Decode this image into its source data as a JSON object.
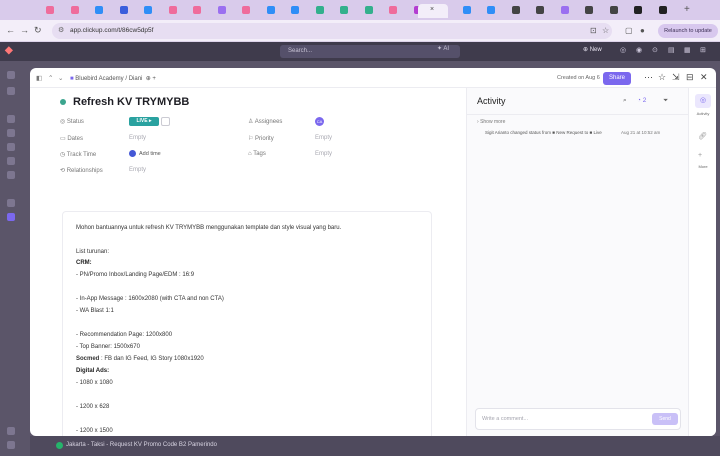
{
  "browser": {
    "url": "app.clickup.com/t/86cw5dp5f",
    "relaunch_label": "Relaunch to update",
    "tab_colors": [
      "#ef6c9b",
      "#ef6c9b",
      "#2f8ef7",
      "#3a5ddc",
      "#2f8ef7",
      "#ef6c9b",
      "#ef6c9b",
      "#9b6ff0",
      "#ef6c9b",
      "#2f8ef7",
      "#2f8ef7",
      "#33b08c",
      "#33b08c",
      "#33b08c",
      "#ef6c9b",
      "#b33dd1",
      "#e1b12c",
      "#2f8ef7",
      "#2f8ef7",
      "#444",
      "#444",
      "#9b6ff0",
      "#444",
      "#444",
      "#222",
      "#222"
    ]
  },
  "app": {
    "search_placeholder": "Search...",
    "ai_label": "AI",
    "new_label": "New"
  },
  "breadcrumb": {
    "space": "Bluebird Academy",
    "list": "Diani"
  },
  "header": {
    "created": "Created on Aug 6",
    "share_label": "Share"
  },
  "task": {
    "title": "Refresh KV TRYMYBB",
    "status_label": "Status",
    "status_value": "LIVE",
    "assignees_label": "Assignees",
    "assignee_initials": "CA",
    "dates_label": "Dates",
    "dates_value": "Empty",
    "priority_label": "Priority",
    "priority_value": "Empty",
    "track_label": "Track Time",
    "track_value": "Add time",
    "tags_label": "Tags",
    "tags_value": "Empty",
    "relationships_label": "Relationships",
    "relationships_value": "Empty"
  },
  "description": {
    "l1": "Mohon bantuannya untuk refresh KV TRYMYBB menggunakan template dan style visual yang baru.",
    "l2": "List turunan:",
    "l3": "CRM:",
    "l4": "- PN/Promo Inbox/Landing Page/EDM : 16:9",
    "l5": "- In-App Message : 1600x2080 (with CTA and non CTA)",
    "l6": "- WA Blast 1:1",
    "l7": "- Recommendation Page: 1200x800",
    "l8": "- Top Banner: 1500x670",
    "l9a": "Socmed",
    "l9b": " : FB dan IG Feed, IG Story 1080x1920",
    "l10": "Digital Ads:",
    "l11": "- 1080 x 1080",
    "l12": "- 1200 x 628",
    "l13": "- 1200 x 1500"
  },
  "activity": {
    "title": "Activity",
    "count": "2",
    "show_more": "Show more",
    "entry": "Sigit Arianto changed status from ■ New Request to ■ Live",
    "time": "Aug 21 at 10:52 am",
    "write_placeholder": "Write a comment...",
    "send_label": "Send"
  },
  "rail": {
    "activity_label": "Activity",
    "more_label": "More"
  },
  "bottom": {
    "text": "Jakarta - Taksi - Request KV Promo Code B2 Pamerindo"
  }
}
